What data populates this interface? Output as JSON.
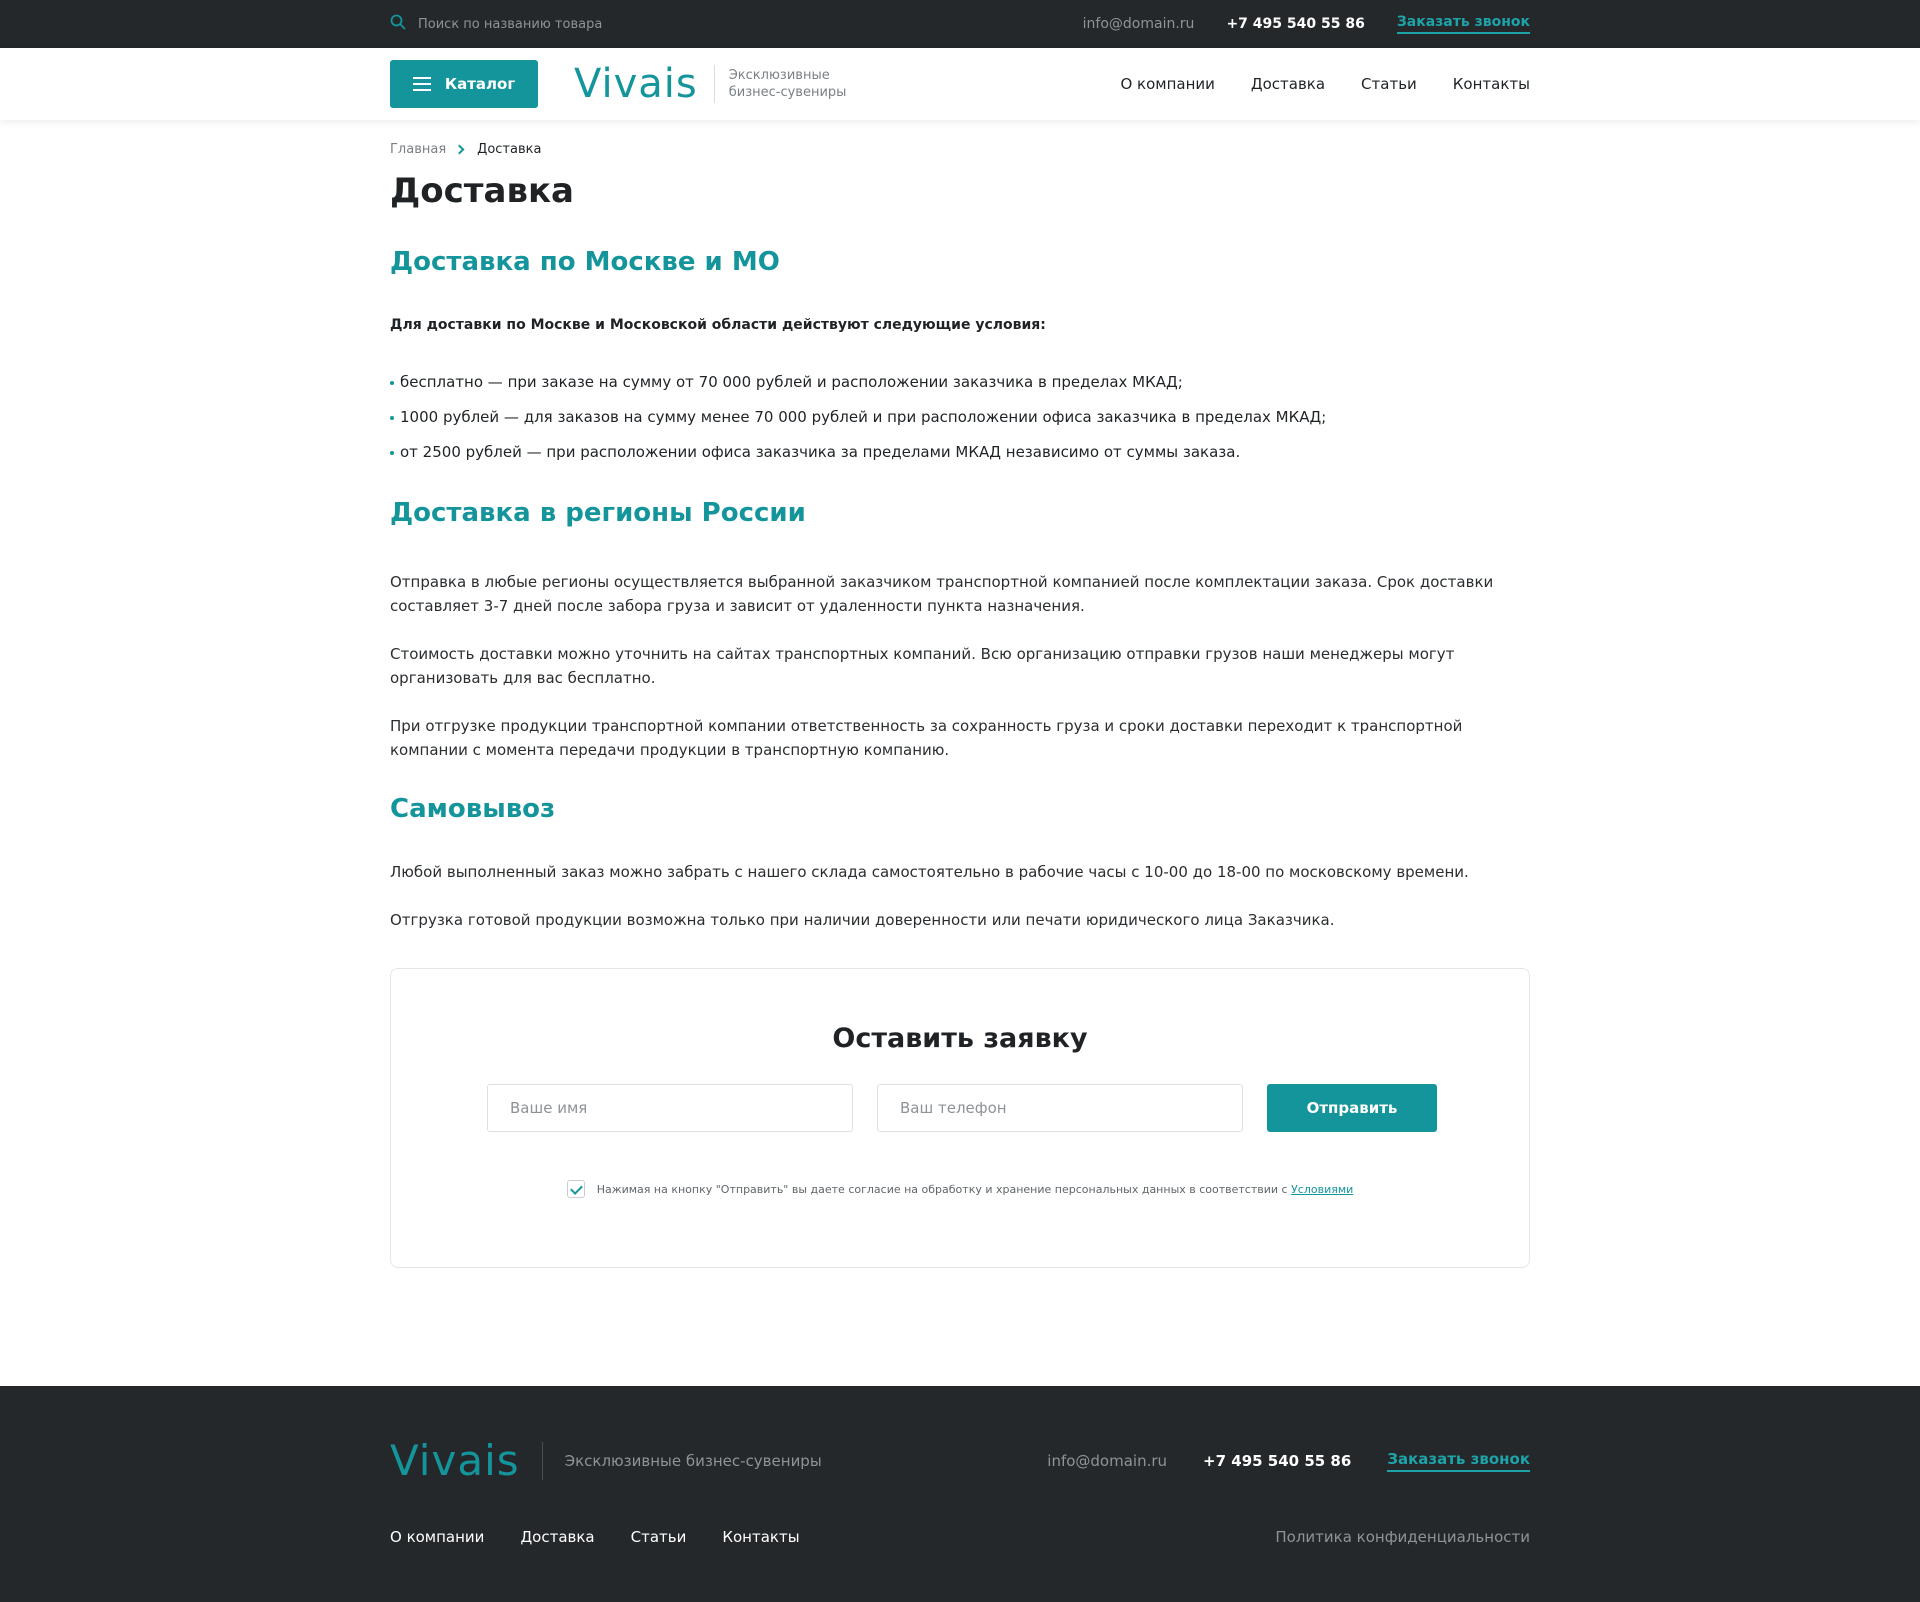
{
  "topbar": {
    "search_placeholder": "Поиск по названию товара",
    "email": "info@domain.ru",
    "phone": "+7 495 540 55 86",
    "callback": "Заказать звонок"
  },
  "header": {
    "catalog_label": "Каталог",
    "logo": "Vivais",
    "tagline": "Эксклюзивные бизнес-сувениры",
    "nav": [
      "О компании",
      "Доставка",
      "Статьи",
      "Контакты"
    ]
  },
  "breadcrumb": {
    "home": "Главная",
    "current": "Доставка"
  },
  "page_title": "Доставка",
  "sections": {
    "moscow": {
      "title": "Доставка по Москве и МО",
      "lead": "Для доставки по Москве и Московской области действуют следующие условия:",
      "items": [
        "бесплатно — при заказе на сумму от 70 000 рублей и расположении заказчика в пределах МКАД;",
        "1000 рублей — для заказов на сумму менее 70 000 рублей и при расположении офиса заказчика в пределах МКАД;",
        "от 2500 рублей — при расположении офиса заказчика за пределами МКАД независимо от суммы заказа."
      ]
    },
    "regions": {
      "title": "Доставка в регионы России",
      "paragraphs": [
        "Отправка в любые регионы осуществляется выбранной заказчиком транспортной компанией после комплектации заказа. Срок доставки составляет 3-7 дней после забора груза и зависит от удаленности пункта назначения.",
        "Стоимость доставки можно уточнить на сайтах транспортных компаний. Всю организацию отправки грузов наши менеджеры могут организовать для вас бесплатно.",
        "При отгрузке продукции транспортной компании ответственность за сохранность груза и сроки доставки переходит к транспортной компании с момента передачи продукции в транспортную компанию."
      ]
    },
    "pickup": {
      "title": "Самовывоз",
      "paragraphs": [
        "Любой выполненный заказ можно забрать с нашего склада самостоятельно в рабочие часы с 10-00 до 18-00 по московскому времени.",
        "Отгрузка готовой продукции возможна только при наличии доверенности или печати юридического лица Заказчика."
      ]
    }
  },
  "form": {
    "title": "Оставить заявку",
    "name_placeholder": "Ваше имя",
    "phone_placeholder": "Ваш телефон",
    "submit_label": "Отправить",
    "consent_text": "Нажимая на кнопку \"Отправить\" вы даете согласие на обработку и хранение персональных данных в соответствии с ",
    "consent_link": "Условиями",
    "consent_checked": true
  },
  "footer": {
    "logo": "Vivais",
    "tagline": "Эксклюзивные бизнес-сувениры",
    "email": "info@domain.ru",
    "phone": "+7 495 540 55 86",
    "callback": "Заказать звонок",
    "nav": [
      "О компании",
      "Доставка",
      "Статьи",
      "Контакты"
    ],
    "policy": "Политика конфиденциальности"
  },
  "colors": {
    "accent": "#14959b",
    "dark": "#24282b",
    "text": "#1f2326",
    "muted": "#8d9397"
  }
}
